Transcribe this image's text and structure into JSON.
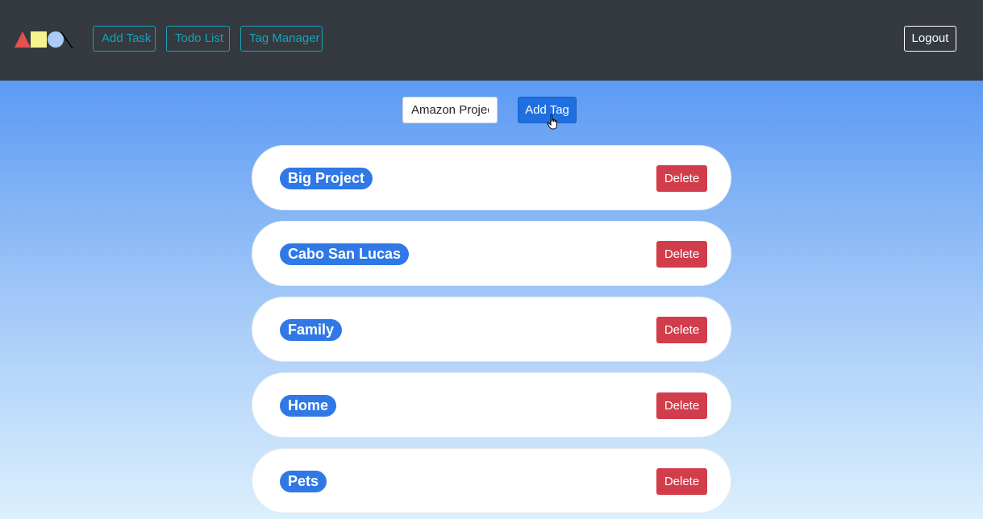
{
  "navbar": {
    "logo_name": "shapes-logo",
    "links": [
      {
        "label": "Add Task"
      },
      {
        "label": "Todo List"
      },
      {
        "label": "Tag Manager"
      }
    ],
    "logout_label": "Logout"
  },
  "tag_form": {
    "input_value": "Amazon Project",
    "add_button_label": "Add Tag"
  },
  "tags": [
    {
      "name": "Big Project",
      "delete_label": "Delete"
    },
    {
      "name": "Cabo San Lucas",
      "delete_label": "Delete"
    },
    {
      "name": "Family",
      "delete_label": "Delete"
    },
    {
      "name": "Home",
      "delete_label": "Delete"
    },
    {
      "name": "Pets",
      "delete_label": "Delete"
    }
  ],
  "colors": {
    "navbar_bg": "#343a40",
    "nav_link": "#17a2b8",
    "primary": "#1f6fe0",
    "tag_pill": "#2f78e6",
    "danger": "#d23d4b",
    "logo_triangle": "#e0524d",
    "logo_square": "#f7f48e",
    "logo_circle": "#a9cdf7"
  }
}
